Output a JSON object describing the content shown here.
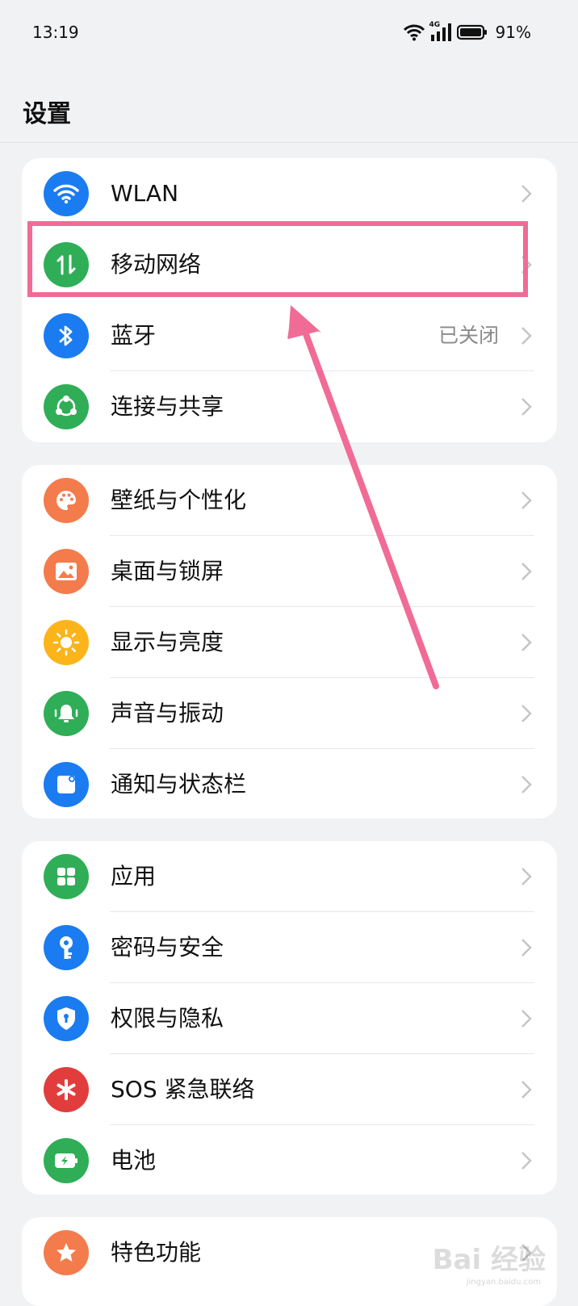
{
  "status_bar": {
    "time": "13:19",
    "network": "4G",
    "battery": "91%"
  },
  "header": {
    "title": "设置"
  },
  "sections": [
    {
      "items": [
        {
          "label": "WLAN",
          "icon": "wifi-icon",
          "color": "#1a7cf0"
        },
        {
          "label": "移动网络",
          "icon": "mobile-data-icon",
          "color": "#2fae57"
        },
        {
          "label": "蓝牙",
          "value": "已关闭",
          "icon": "bluetooth-icon",
          "color": "#1a7cf0"
        },
        {
          "label": "连接与共享",
          "icon": "share-icon",
          "color": "#2fae57"
        }
      ]
    },
    {
      "items": [
        {
          "label": "壁纸与个性化",
          "icon": "palette-icon",
          "color": "#f47b4c"
        },
        {
          "label": "桌面与锁屏",
          "icon": "image-icon",
          "color": "#f47b4c"
        },
        {
          "label": "显示与亮度",
          "icon": "sun-icon",
          "color": "#fbb41a"
        },
        {
          "label": "声音与振动",
          "icon": "bell-icon",
          "color": "#2fae57"
        },
        {
          "label": "通知与状态栏",
          "icon": "notification-icon",
          "color": "#1a7cf0"
        }
      ]
    },
    {
      "items": [
        {
          "label": "应用",
          "icon": "apps-icon",
          "color": "#2fae57"
        },
        {
          "label": "密码与安全",
          "icon": "key-icon",
          "color": "#1a7cf0"
        },
        {
          "label": "权限与隐私",
          "icon": "shield-icon",
          "color": "#1a7cf0"
        },
        {
          "label": "SOS 紧急联络",
          "icon": "sos-icon",
          "color": "#e23d3d"
        },
        {
          "label": "电池",
          "icon": "battery-icon",
          "color": "#2fae57"
        }
      ]
    },
    {
      "items": [
        {
          "label": "特色功能",
          "icon": "star-icon",
          "color": "#f47b4c"
        }
      ]
    }
  ],
  "annotation": {
    "color": "#f06b95"
  },
  "watermark": {
    "text": "Bai 经验",
    "sub": "jingyan.baidu.com"
  }
}
